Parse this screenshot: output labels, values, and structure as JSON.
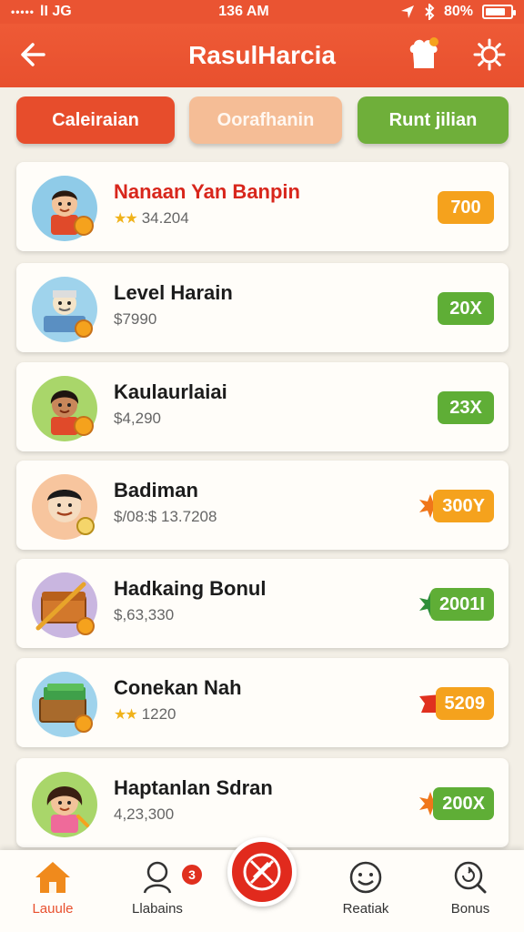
{
  "status_bar": {
    "signal": "•••••",
    "carrier": "lI JG",
    "time": "136 AM",
    "battery": "80%",
    "battery_level": 0.8
  },
  "header": {
    "title": "RasulHarcia"
  },
  "tabs": [
    {
      "label": "Caleiraian",
      "color": "#e74d2c"
    },
    {
      "label": "Oorafhanin",
      "color": "#f5bd96"
    },
    {
      "label": "Runt jilian",
      "color": "#6faf3a"
    }
  ],
  "items": [
    {
      "name": "Nanaan Yan Banpin",
      "name_color": "#d8261c",
      "rating": "34.204",
      "value": "",
      "badge": "700",
      "badge_color": "orange",
      "has_stars": true,
      "avatar": "boy-avatar-icon"
    },
    {
      "name": "Level Harain",
      "rating": "",
      "value": "$7990",
      "badge": "20X",
      "badge_color": "green",
      "has_stars": false,
      "avatar": "cashier-avatar-icon"
    },
    {
      "name": "Kaulaurlaiai",
      "rating": "",
      "value": "$4,290",
      "badge": "23X",
      "badge_color": "green",
      "has_stars": false,
      "avatar": "girl-avatar-icon"
    },
    {
      "name": "Badiman",
      "rating": "",
      "value": "$/08:$ 13.7208",
      "badge": "300Y",
      "badge_color": "orange",
      "has_stars": false,
      "avatar": "man-avatar-icon"
    },
    {
      "name": "Hadkaing Bonul",
      "rating": "",
      "value": "$,63,330",
      "badge": "2001I",
      "badge_color": "green",
      "has_stars": false,
      "avatar": "chest-avatar-icon"
    },
    {
      "name": "Conekan Nah",
      "rating": "1220",
      "value": "",
      "badge": "5209",
      "badge_color": "orange",
      "has_stars": true,
      "avatar": "money-box-avatar-icon"
    },
    {
      "name": "Haptanlan Sdran",
      "rating": "",
      "value": "4,23,300",
      "badge": "200X",
      "badge_color": "green",
      "has_stars": false,
      "avatar": "kid-avatar-icon"
    }
  ],
  "bottom_nav": {
    "home": "Lauule",
    "leaders": "Llabains",
    "leaders_count": "3",
    "feedback": "Reatiak",
    "bonus": "Bonus"
  },
  "colors": {
    "primary": "#e8502e",
    "orange": "#f5a21d",
    "green": "#5fae36"
  }
}
